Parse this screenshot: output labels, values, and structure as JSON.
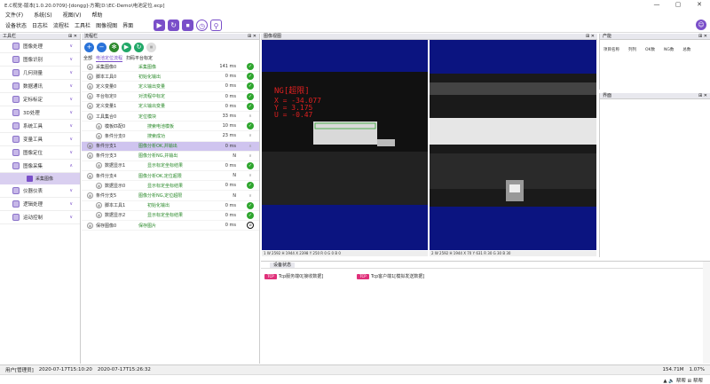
{
  "window": {
    "title": "E.C视觉-版本[1.0.20.0709]-[dongg]-方案[D:\\EC-Demo\\电池定位.ecp]",
    "minimize": "—",
    "maximize": "▢",
    "close": "✕"
  },
  "menu": [
    "文件(F)",
    "系统(S)",
    "视图(V)",
    "帮助"
  ],
  "toolbar": {
    "labels": [
      "设备状态",
      "日志栏",
      "流程栏",
      "工具栏",
      "图像视图",
      "界面"
    ]
  },
  "toolpanel": {
    "title": "工具栏",
    "categories": [
      "图像处理",
      "图像识别",
      "几何测量",
      "数据通讯",
      "定标标定",
      "3D处理",
      "系统工具",
      "变量工具",
      "图像定位",
      "图像采集"
    ],
    "subitem": "采集图像",
    "categories_after": [
      "仪器仪表",
      "逻辑处理",
      "运动控制"
    ]
  },
  "flowpanel": {
    "title": "流程栏",
    "tabs": [
      "全部",
      "电池定位流程",
      "扫码平台标定"
    ],
    "rows": [
      {
        "name": "采集图像0",
        "desc": "采集图像",
        "time": "141 ms",
        "status": "ok",
        "indent": 0
      },
      {
        "name": "脚本工具0",
        "desc": "初始化输出",
        "time": "0 ms",
        "status": "ok",
        "indent": 0
      },
      {
        "name": "定义变量0",
        "desc": "定义输出变量",
        "time": "0 ms",
        "status": "ok",
        "indent": 0
      },
      {
        "name": "平台标定0",
        "desc": "对流程中标定",
        "time": "0 ms",
        "status": "ok",
        "indent": 0
      },
      {
        "name": "定义变量1",
        "desc": "定义输出变量",
        "time": "0 ms",
        "status": "ok",
        "indent": 0
      },
      {
        "name": "工具集合0",
        "desc": "定位模块",
        "time": "33 ms",
        "status": "collapse",
        "indent": 0
      },
      {
        "name": "模板匹配0",
        "desc": "搜索电池模板",
        "time": "10 ms",
        "status": "ok",
        "indent": 1
      },
      {
        "name": "条件分支0",
        "desc": "搜索成功",
        "time": "23 ms",
        "status": "none",
        "indent": 1
      },
      {
        "name": "条件分支1",
        "desc": "图像分析OK,并输出",
        "time": "0 ms",
        "status": "collapse",
        "indent": 0,
        "selected": true
      },
      {
        "name": "条件分支3",
        "desc": "图像分析NG,并输出",
        "time": "N",
        "status": "none",
        "indent": 0
      },
      {
        "name": "数据显示1",
        "desc": "显示标定坐标结果",
        "time": "0 ms",
        "status": "ok",
        "indent": 1
      },
      {
        "name": "条件分支4",
        "desc": "图像分析OK,定位超限",
        "time": "N",
        "status": "none",
        "indent": 0
      },
      {
        "name": "数据显示0",
        "desc": "显示标定坐标结果",
        "time": "0 ms",
        "status": "ok",
        "indent": 1
      },
      {
        "name": "条件分支5",
        "desc": "图像分析NG,定位超限",
        "time": "N",
        "status": "none",
        "indent": 0
      },
      {
        "name": "脚本工具1",
        "desc": "初始化输出",
        "time": "0 ms",
        "status": "ok",
        "indent": 1
      },
      {
        "name": "数据显示2",
        "desc": "显示标定坐标结果",
        "time": "0 ms",
        "status": "ok",
        "indent": 1
      },
      {
        "name": "保存图像0",
        "desc": "保存图片",
        "time": "0 ms",
        "status": "forbid",
        "indent": 0
      }
    ]
  },
  "imgpanel": {
    "title": "图像视图",
    "overlay": {
      "status": "NG[超限]",
      "x": "X = -34.077",
      "y": "Y = 3.175",
      "u": "U = -0.47"
    },
    "left_status": "1  W 2592  H 1944  X 2398  Y 250  R 0  G 0  B 0",
    "right_status": "2  W 2592  H 1944  X 70  Y 631  R 30  G 30  B 30"
  },
  "prodpanel": {
    "title": "产能",
    "cols": [
      "项目名称",
      "列列",
      "OK数",
      "NG数",
      "总数"
    ]
  },
  "viewpanel": {
    "title": "界面"
  },
  "devpanel": {
    "tab": "设备状态",
    "devices": [
      {
        "icon": "TCP",
        "label": "Tcp服务端0[接收数据]"
      },
      {
        "icon": "TCP",
        "label": "Tcp客户端1[模拟发送数据]"
      }
    ]
  },
  "statusbar": {
    "user": "用户[管理员]",
    "time1": "2020-07-17T15:10:20",
    "time2": "2020-07-17T15:26:32",
    "memory": "154.71M",
    "cpu": "1.07%"
  },
  "bottombar": {
    "right": "▲ 🔈 帮帮  ⊞ 帮帮"
  },
  "colors": {
    "accent": "#7a4fc9",
    "ok": "#2ea52e",
    "ng": "#e02020",
    "image_bg": "#0b1480"
  }
}
